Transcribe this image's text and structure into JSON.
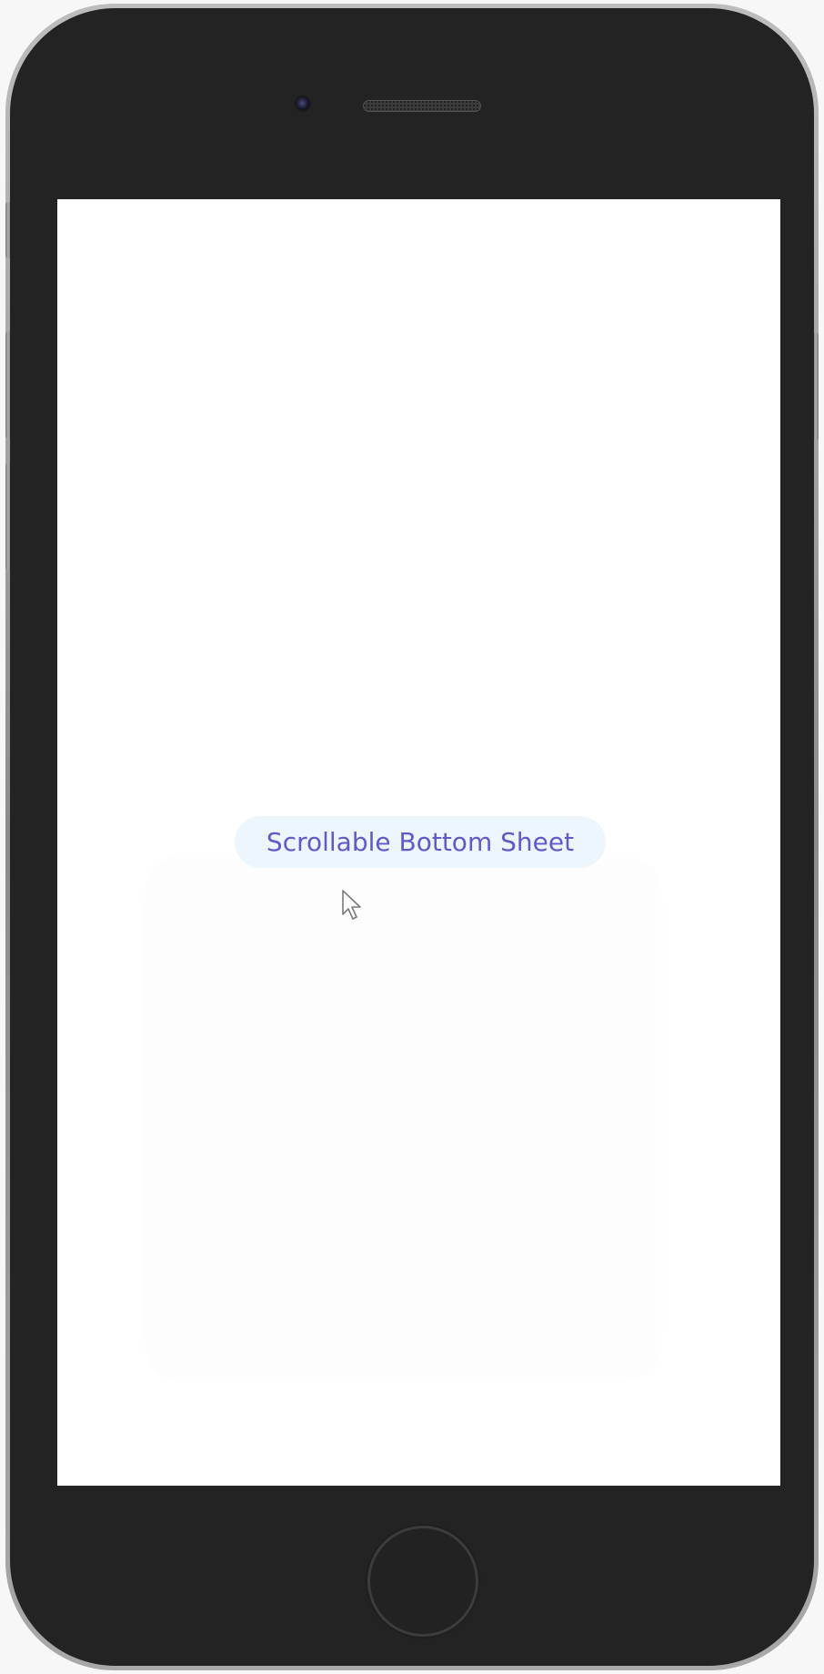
{
  "device": {
    "frame_color": "#232323",
    "screen_color": "#ffffff"
  },
  "screen": {
    "open_sheet_button": {
      "label": "Scrollable Bottom Sheet",
      "background": "#edf5fd",
      "text_color": "#6558c9"
    }
  },
  "icons": {
    "cursor": "mouse-pointer-icon",
    "camera": "front-camera-icon",
    "speaker": "earpiece-speaker-icon",
    "home": "home-button-icon"
  }
}
